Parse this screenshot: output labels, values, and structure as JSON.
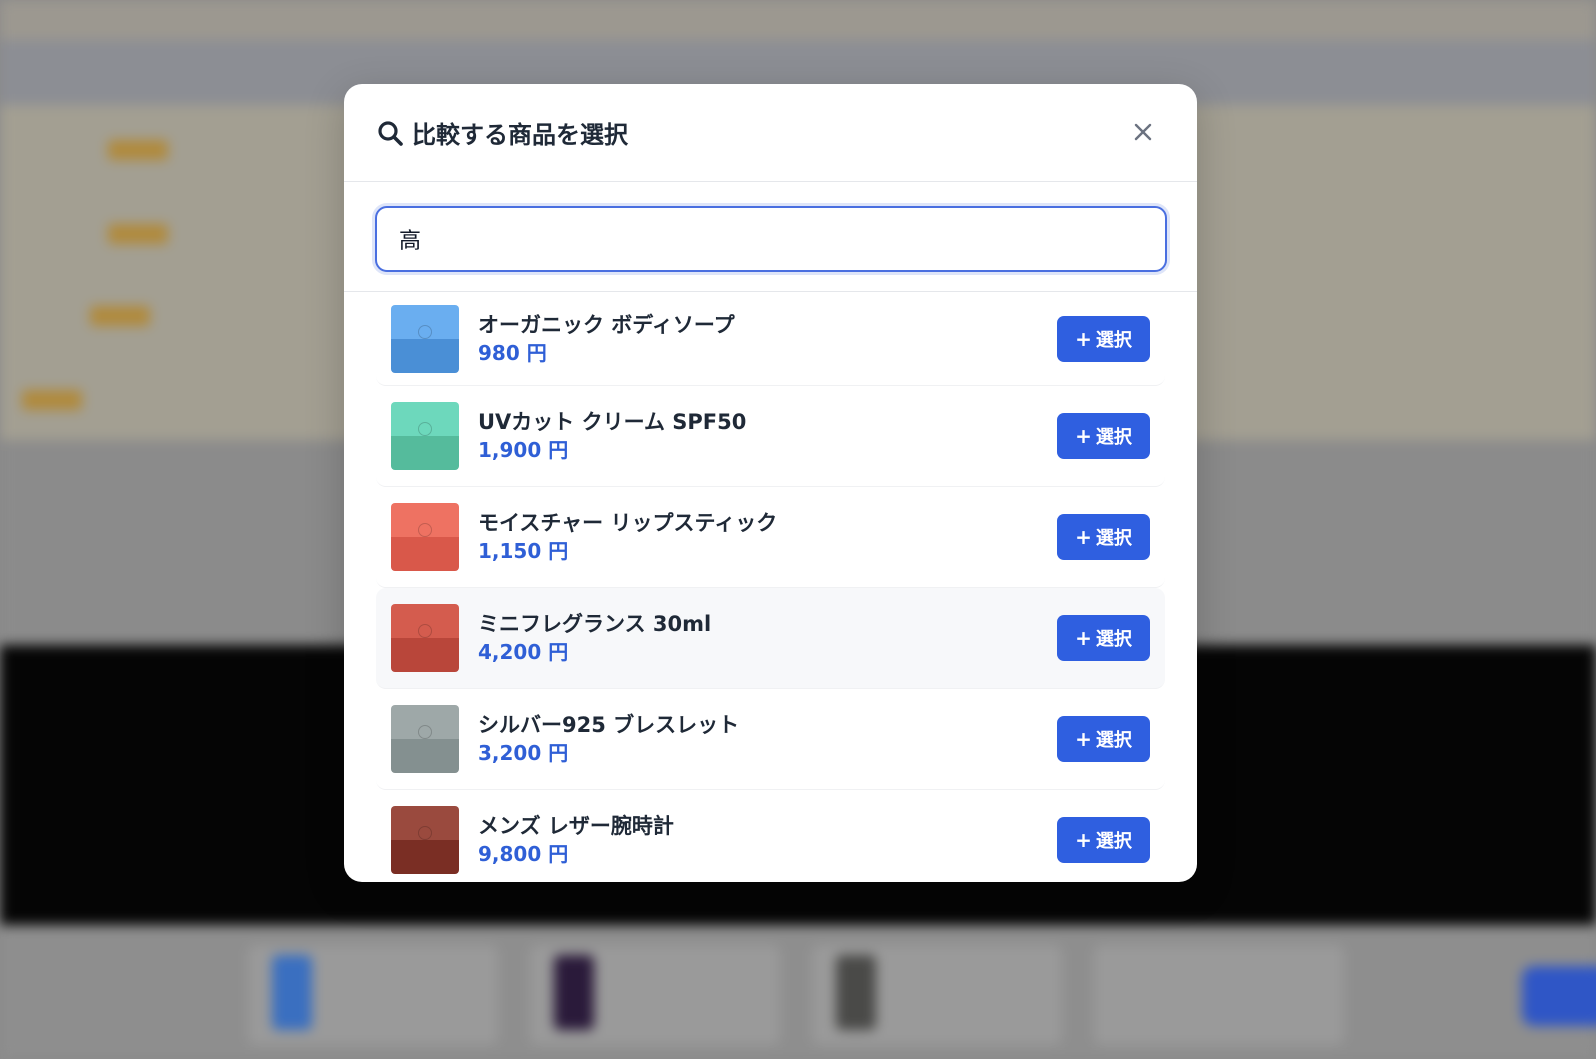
{
  "modal": {
    "title": "比較する商品を選択",
    "search": {
      "value": "高"
    },
    "items": [
      {
        "name": "オーガニック ボディソープ",
        "price": "980 円",
        "button": "選択",
        "colors": [
          "#6aaef0",
          "#4a8fd6"
        ]
      },
      {
        "name": "UVカット クリーム SPF50",
        "price": "1,900 円",
        "button": "選択",
        "colors": [
          "#6dd8bc",
          "#55bb9c"
        ]
      },
      {
        "name": "モイスチャー リップスティック",
        "price": "1,150 円",
        "button": "選択",
        "colors": [
          "#ee7262",
          "#d9584a"
        ]
      },
      {
        "name": "ミニフレグランス 30ml",
        "price": "4,200 円",
        "button": "選択",
        "colors": [
          "#d45c4e",
          "#b9463a"
        ]
      },
      {
        "name": "シルバー925 ブレスレット",
        "price": "3,200 円",
        "button": "選択",
        "colors": [
          "#9ea8a8",
          "#849090"
        ]
      },
      {
        "name": "メンズ レザー腕時計",
        "price": "9,800 円",
        "button": "選択",
        "colors": [
          "#9a4a3e",
          "#7a2e24"
        ]
      }
    ]
  },
  "icons": {
    "header": "search-icon",
    "close": "close-icon"
  },
  "accent": "#2f5fe0"
}
